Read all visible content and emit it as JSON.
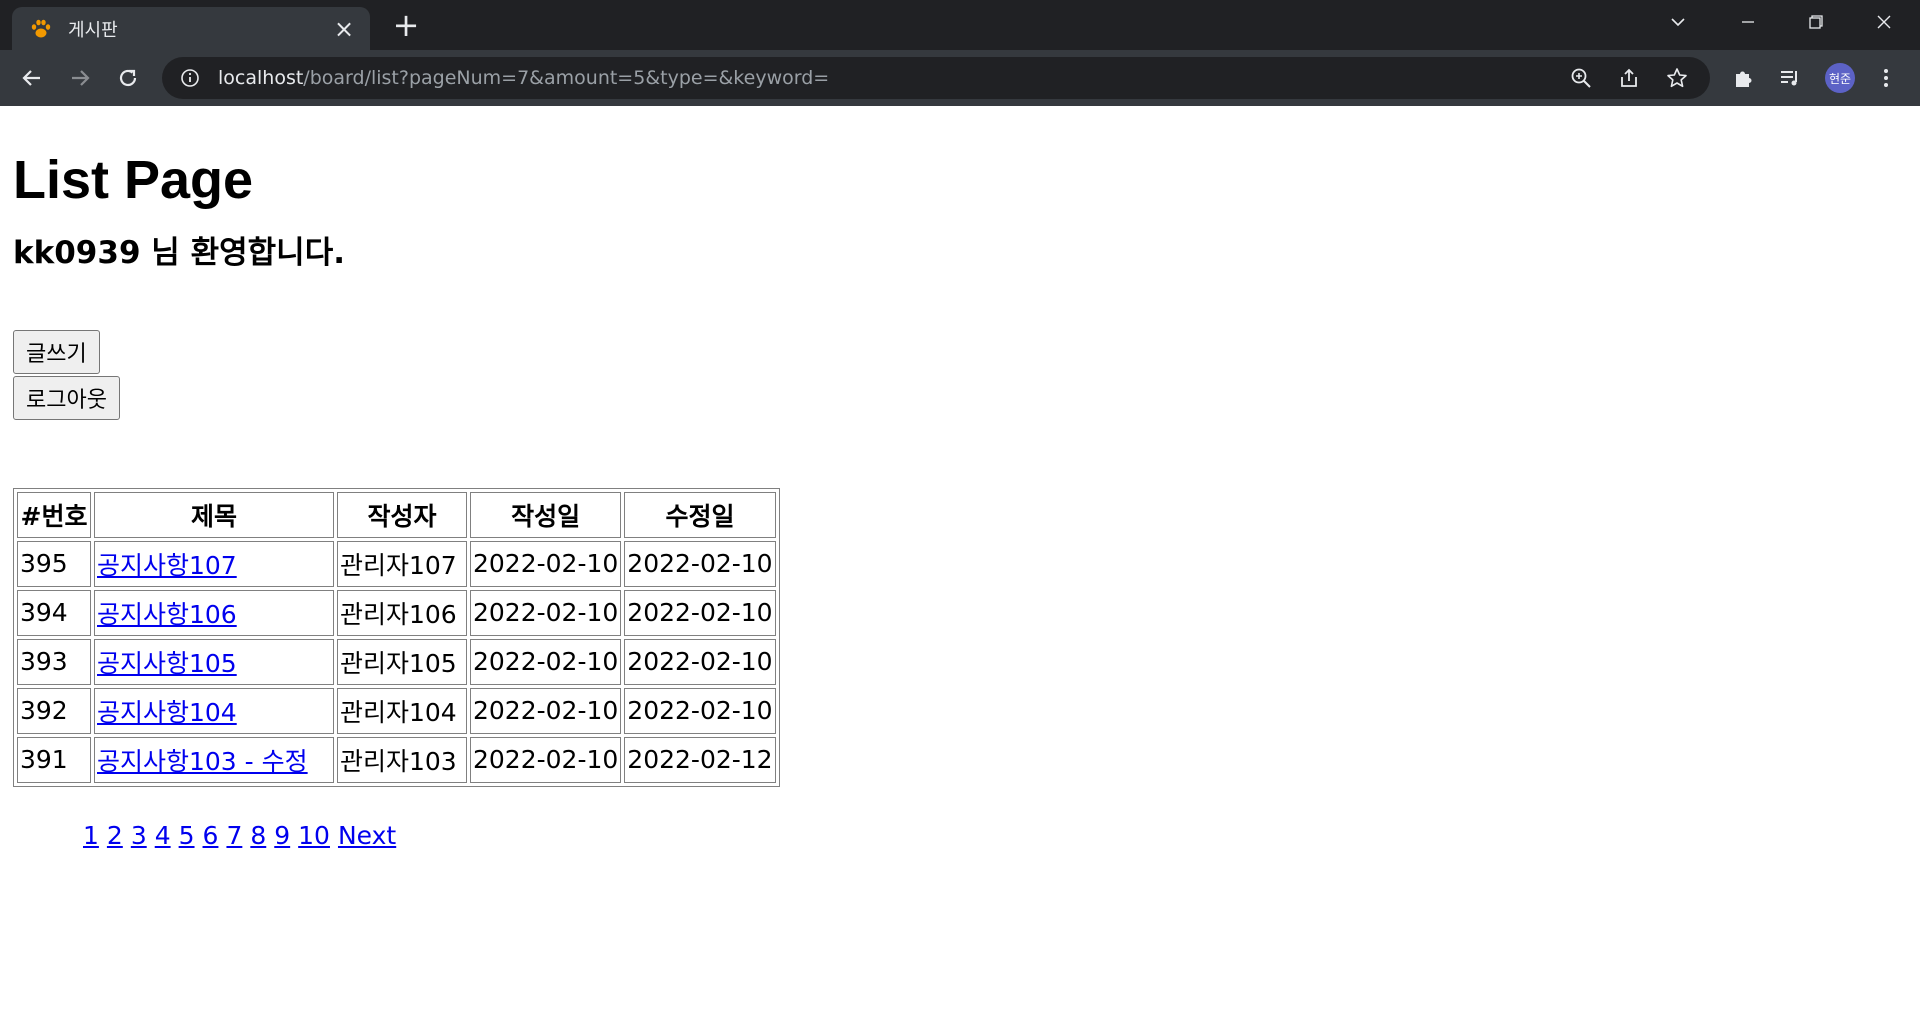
{
  "browser": {
    "tab_title": "게시판",
    "url_host": "localhost",
    "url_path": "/board/list?pageNum=7&amount=5&type=&keyword=",
    "profile_initials": "현준",
    "accent_color": "#5c62c6"
  },
  "page": {
    "title": "List Page",
    "welcome": "kk0939 님 환영합니다.",
    "write_button": "글쓰기",
    "logout_button": "로그아웃"
  },
  "table": {
    "headers": [
      "#번호",
      "제목",
      "작성자",
      "작성일",
      "수정일"
    ],
    "rows": [
      {
        "no": "395",
        "title": "공지사항107",
        "writer": "관리자107",
        "regdate": "2022-02-10",
        "updatedate": "2022-02-10"
      },
      {
        "no": "394",
        "title": "공지사항106",
        "writer": "관리자106",
        "regdate": "2022-02-10",
        "updatedate": "2022-02-10"
      },
      {
        "no": "393",
        "title": "공지사항105",
        "writer": "관리자105",
        "regdate": "2022-02-10",
        "updatedate": "2022-02-10"
      },
      {
        "no": "392",
        "title": "공지사항104",
        "writer": "관리자104",
        "regdate": "2022-02-10",
        "updatedate": "2022-02-10"
      },
      {
        "no": "391",
        "title": "공지사항103 - 수정",
        "writer": "관리자103",
        "regdate": "2022-02-10",
        "updatedate": "2022-02-12"
      }
    ]
  },
  "pagination": {
    "pages": [
      "1",
      "2",
      "3",
      "4",
      "5",
      "6",
      "7",
      "8",
      "9",
      "10"
    ],
    "next_label": "Next"
  }
}
